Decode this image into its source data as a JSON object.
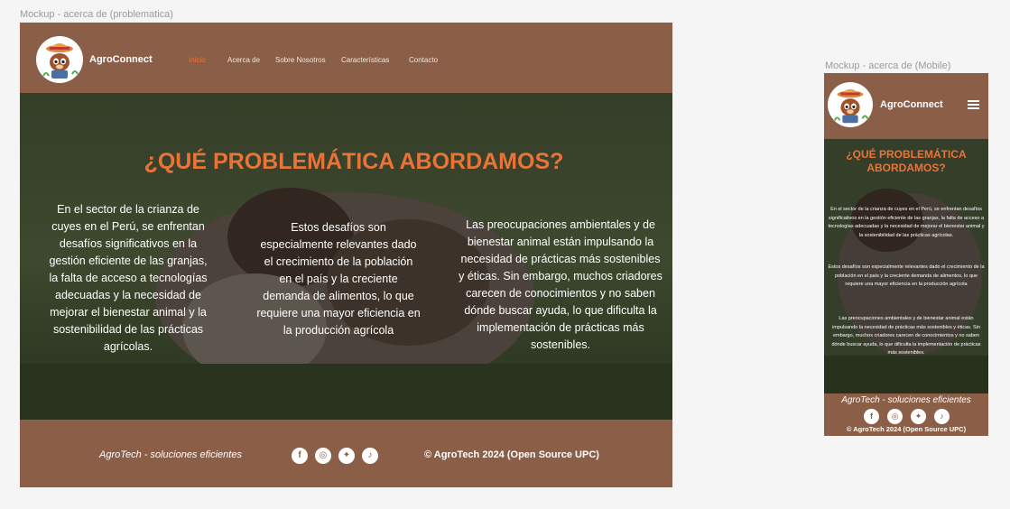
{
  "desktop": {
    "frame_label": "Mockup - acerca de (problematica)",
    "brand": "AgroConnect",
    "nav": [
      "Inicio",
      "Acerca de",
      "Sobre Nosotros",
      "Características",
      "Contacto"
    ],
    "hero_title": "¿QUÉ PROBLEMÁTICA ABORDAMOS?",
    "col1": "En el sector de la crianza de cuyes en el Perú, se enfrentan desafíos  significativos en la gestión eficiente de las granjas, la falta de  acceso a tecnologías adecuadas y la necesidad de mejorar el bienestar  animal y la sostenibilidad de las prácticas agrícolas.",
    "col2": "Estos desafíos son especialmente relevantes dado el crecimiento de la población en el país y la creciente demanda de alimentos, lo que requiere una mayor eficiencia en la producción agrícola",
    "col3": "Las preocupaciones ambientales y de bienestar animal están impulsando  la necesidad de prácticas más sostenibles y éticas. Sin embargo, muchos  criadores carecen de conocimientos y no saben dónde buscar ayuda, lo que  dificulta la implementación de prácticas más sostenibles.",
    "footer_tagline": "AgroTech - soluciones eficientes",
    "copyright": "© AgroTech 2024 (Open Source UPC)",
    "social": [
      "facebook-icon",
      "instagram-icon",
      "twitter-icon",
      "tiktok-icon"
    ]
  },
  "mobile": {
    "frame_label": "Mockup - acerca de (Mobile)",
    "brand": "AgroConnect",
    "hero_title": "¿QUÉ PROBLEMÁTICA ABORDAMOS?",
    "p1": "En el sector de la crianza de cuyes en el Perú, se enfrentan desafíos  significativos en la gestión eficiente de las granjas, la falta de  acceso a tecnologías adecuadas y la necesidad de mejorar el bienestar  animal y la sostenibilidad de las prácticas agrícolas.",
    "p2": "Estos desafíos son especialmente relevantes dado el crecimiento de la  población en el país y la creciente demanda de alimentos, lo que requiere una mayor eficiencia en la producción agrícola",
    "p3": "Las preocupaciones ambientales y de bienestar animal están impulsando  la necesidad de prácticas más sostenibles y éticas. Sin embargo, muchos  criadores carecen de conocimientos y no saben dónde buscar ayuda, lo que  dificulta la implementación de prácticas más sostenibles.",
    "footer_tagline": "AgroTech - soluciones eficientes",
    "copyright": "© AgroTech 2024 (Open Source UPC)"
  },
  "colors": {
    "brown": "#8b5e48",
    "accent": "#e8743a",
    "canvas": "#f5f5f5"
  }
}
